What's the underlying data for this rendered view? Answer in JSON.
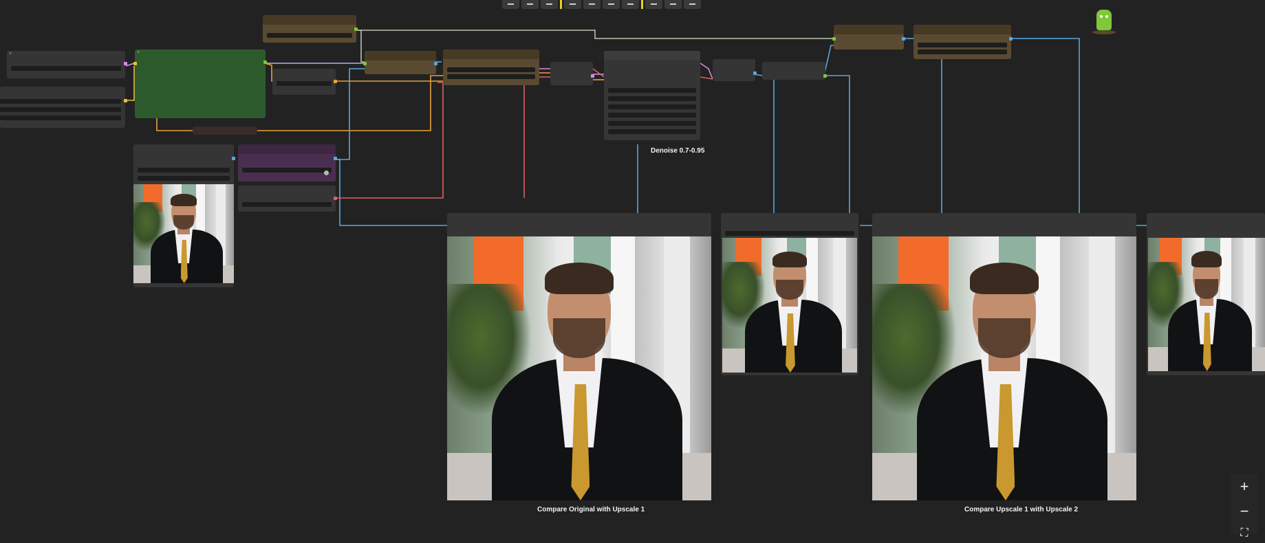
{
  "toolbar": {
    "icons": [
      "align-left-icon",
      "align-center-icon",
      "align-right-icon",
      "align-top-icon",
      "align-middle-icon",
      "align-bottom-icon",
      "distribute-h-icon",
      "distribute-v-icon",
      "pin-icon",
      "collapse-icon"
    ]
  },
  "labels": {
    "denoise": "Denoise 0.7-0.95",
    "compare1": "Compare Original with Upscale 1",
    "compare2": "Compare Upscale 1 with Upscale 2"
  },
  "zoom": {
    "in": "+",
    "out": "−",
    "fit": "⛶"
  },
  "colors": {
    "background": "#222222",
    "node": "#353535",
    "green_node": "#2d5a2d",
    "brown_node": "#594a31",
    "purple_node": "#4a2e50",
    "wire_blue": "#5aa6e0",
    "wire_orange": "#e6a33a",
    "wire_red": "#e06060",
    "wire_pink": "#d88ae6",
    "wire_white": "#b9c3b0"
  }
}
